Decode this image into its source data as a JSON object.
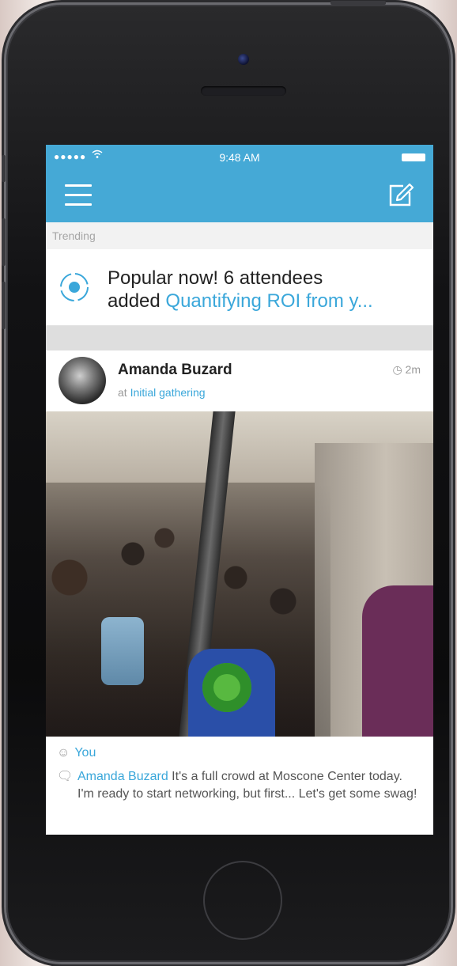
{
  "status_bar": {
    "signal": "●●●●●",
    "time": "9:48 AM"
  },
  "nav": {
    "menu_icon": "hamburger-menu-icon",
    "compose_icon": "compose-edit-icon"
  },
  "section": {
    "trending_label": "Trending"
  },
  "trending_item": {
    "icon": "trending-target-icon",
    "line1": "Popular now! 6 attendees",
    "prefix": "added ",
    "link_text": "Quantifying ROI from y..."
  },
  "post": {
    "author": "Amanda Buzard",
    "location_prefix": "at ",
    "location_name": "Initial gathering",
    "time_ago": "2m",
    "likes_label": "You",
    "comment_author": "Amanda Buzard",
    "comment_text": " It's a full crowd at Moscone Center today. I'm ready to start networking, but first... Let's get some swag!"
  },
  "colors": {
    "brand_blue": "#45a9d6",
    "link_blue": "#3aa7da",
    "muted_gray": "#9a9a9a"
  }
}
